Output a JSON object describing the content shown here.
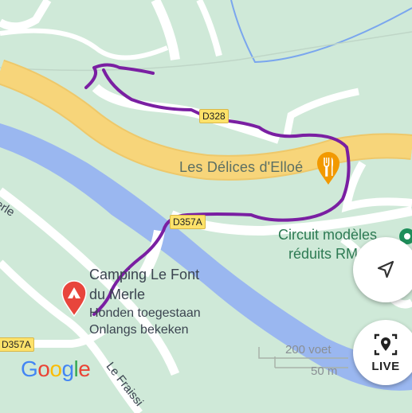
{
  "roads": {
    "d328": "D328",
    "d357a_top": "D357A",
    "d357a_left": "D357A",
    "merle_left": "erle",
    "le_fraissi": "Le Fraissi"
  },
  "places": {
    "restaurant": "Les Délices d'Elloé",
    "circuit_line1": "Circuit modèles",
    "circuit_line2": "réduits RM",
    "camp_line1": "Camping Le Font",
    "camp_line2": "du Merle",
    "camp_sub1": "Honden toegestaan",
    "camp_sub2": "Onlangs bekeken"
  },
  "scale": {
    "feet": "200 voet",
    "meters": "50 m"
  },
  "controls": {
    "live_label": "LIVE"
  },
  "branding": {
    "google": [
      "G",
      "o",
      "o",
      "g",
      "l",
      "e"
    ],
    "google_colors": [
      "#4285F4",
      "#EA4335",
      "#FBBC05",
      "#4285F4",
      "#34A853",
      "#EA4335"
    ]
  },
  "colors": {
    "water": "#9ab7f0",
    "land": "#cfe9d8",
    "highway": "#f7d57a",
    "route": "#7a1fa2",
    "camp_pin": "#e8453c",
    "restaurant_pin": "#f29900",
    "circuit_pin": "#1e8e5a"
  },
  "icons": {
    "restaurant": "fork-knife-icon",
    "camp": "tent-icon",
    "circuit": "green-poi-icon",
    "navigate": "navigation-arrow-icon",
    "live": "live-view-pin-icon"
  }
}
